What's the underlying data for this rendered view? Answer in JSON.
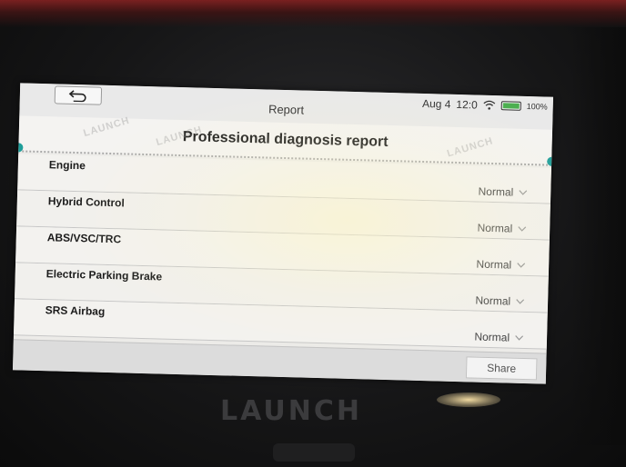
{
  "device": {
    "brand": "LAUNCH"
  },
  "screen": {
    "title": "Report",
    "status_bar": {
      "date": "Aug 4",
      "time": "12:0",
      "battery_percent": "100%",
      "battery_level": 1.0
    },
    "report": {
      "heading": "Professional diagnosis report",
      "systems": [
        {
          "name": "Engine",
          "status": "Normal"
        },
        {
          "name": "Hybrid Control",
          "status": "Normal"
        },
        {
          "name": "ABS/VSC/TRC",
          "status": "Normal"
        },
        {
          "name": "Electric Parking Brake",
          "status": "Normal"
        },
        {
          "name": "SRS Airbag",
          "status": "Normal"
        }
      ]
    },
    "actions": {
      "share_label": "Share"
    },
    "watermark_text": "LAUNCH"
  },
  "colors": {
    "accent_teal": "#1f9e9a",
    "battery_green": "#4caf50"
  },
  "icons": [
    "back-icon",
    "wifi-icon",
    "battery-icon",
    "chevron-down-icon"
  ]
}
